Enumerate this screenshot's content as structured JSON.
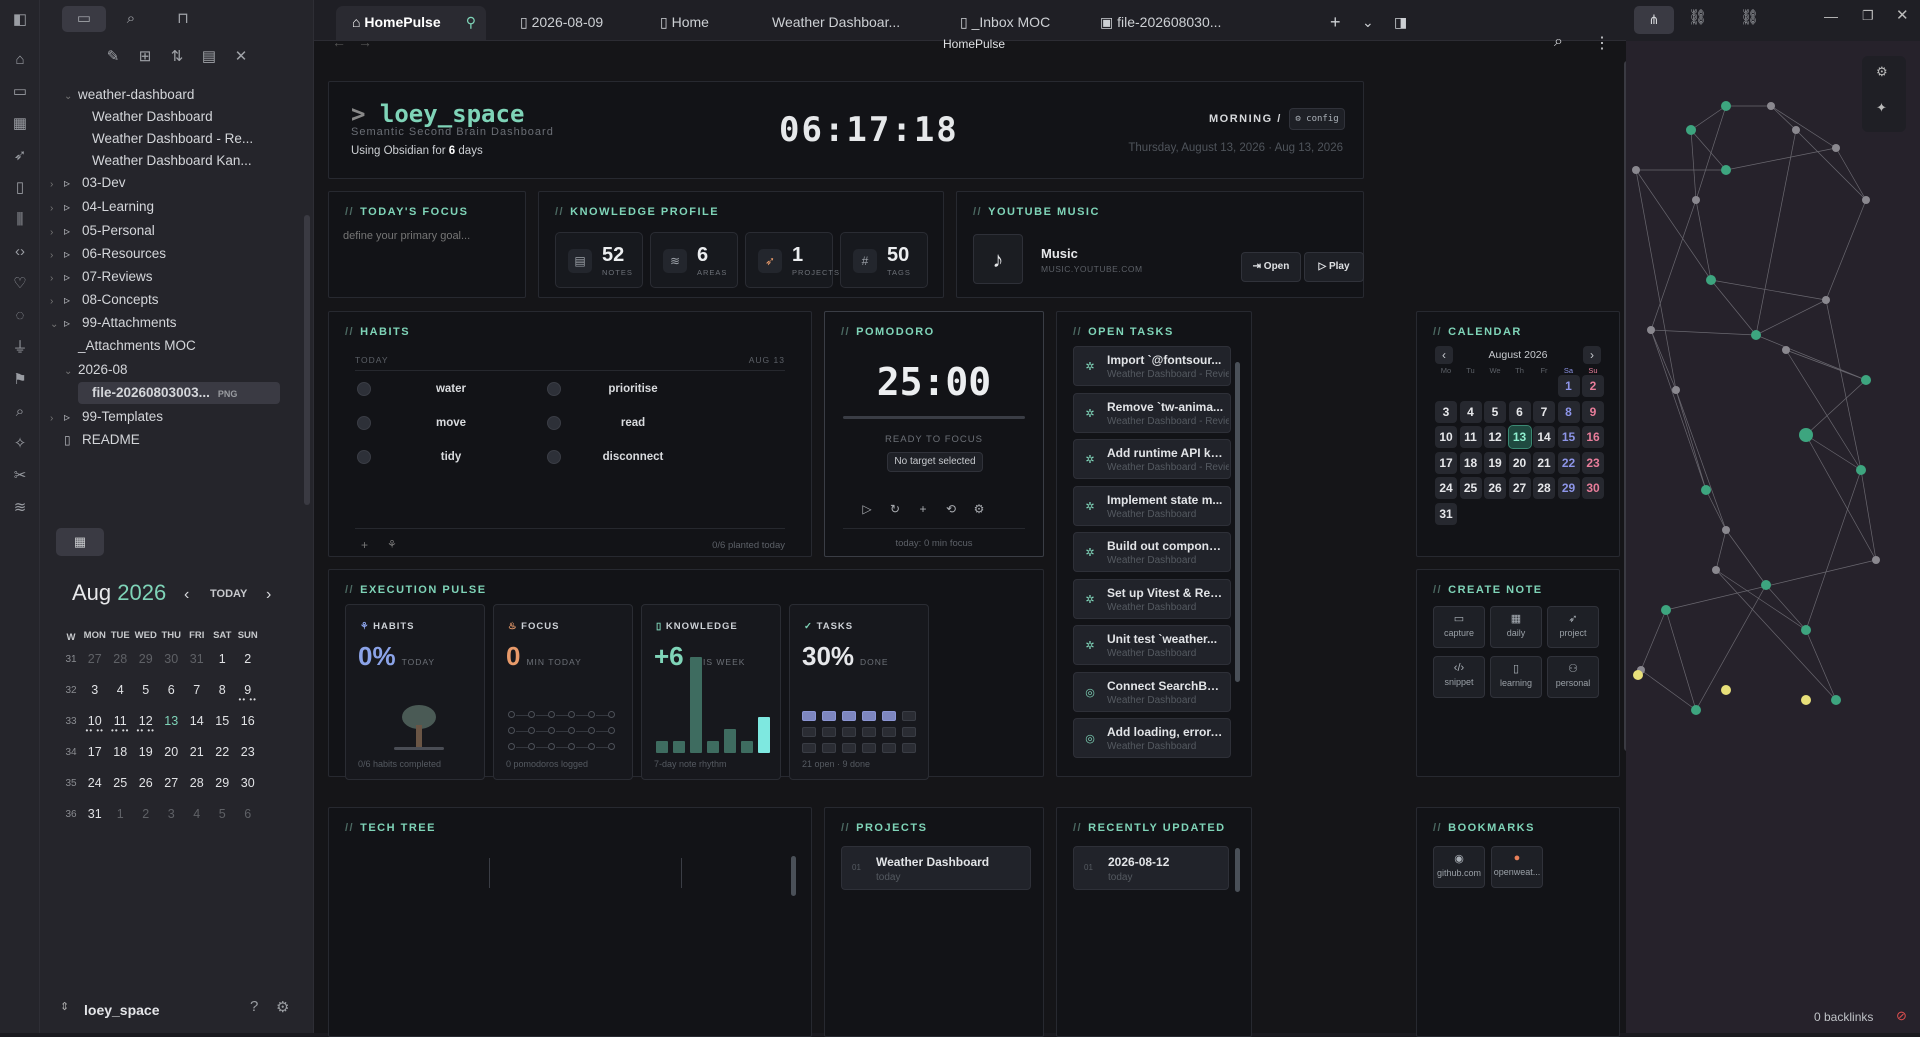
{
  "sidebar": {
    "tree": [
      {
        "label": "weather-dashboard",
        "type": "folder-open",
        "indent": 1
      },
      {
        "label": "Weather Dashboard",
        "type": "file",
        "indent": 2
      },
      {
        "label": "Weather Dashboard - Re...",
        "type": "file",
        "indent": 2
      },
      {
        "label": "Weather Dashboard Kan...",
        "type": "file",
        "indent": 2
      },
      {
        "label": "03-Dev",
        "type": "folder",
        "indent": 0
      },
      {
        "label": "04-Learning",
        "type": "folder",
        "indent": 0
      },
      {
        "label": "05-Personal",
        "type": "folder",
        "indent": 0
      },
      {
        "label": "06-Resources",
        "type": "folder",
        "indent": 0
      },
      {
        "label": "07-Reviews",
        "type": "folder",
        "indent": 0
      },
      {
        "label": "08-Concepts",
        "type": "folder",
        "indent": 0
      },
      {
        "label": "99-Attachments",
        "type": "folder-open",
        "indent": 0
      },
      {
        "label": "_Attachments MOC",
        "type": "file",
        "indent": 1
      },
      {
        "label": "2026-08",
        "type": "folder-open",
        "indent": 1
      },
      {
        "label": "file-20260803003...",
        "badge": "PNG",
        "type": "selected",
        "indent": 2
      },
      {
        "label": "99-Templates",
        "type": "folder",
        "indent": 0
      },
      {
        "label": "README",
        "type": "file",
        "indent": 0
      }
    ],
    "vault_name": "loey_space",
    "calendar": {
      "month": "Aug",
      "year": "2026",
      "today_label": "TODAY",
      "headers": [
        "W",
        "MON",
        "TUE",
        "WED",
        "THU",
        "FRI",
        "SAT",
        "SUN"
      ],
      "weeks": [
        {
          "wk": "31",
          "days": [
            "27",
            "28",
            "29",
            "30",
            "31",
            "1",
            "2"
          ]
        },
        {
          "wk": "32",
          "days": [
            "3",
            "4",
            "5",
            "6",
            "7",
            "8",
            "9"
          ]
        },
        {
          "wk": "33",
          "days": [
            "10",
            "11",
            "12",
            "13",
            "14",
            "15",
            "16"
          ]
        },
        {
          "wk": "34",
          "days": [
            "17",
            "18",
            "19",
            "20",
            "21",
            "22",
            "23"
          ]
        },
        {
          "wk": "35",
          "days": [
            "24",
            "25",
            "26",
            "27",
            "28",
            "29",
            "30"
          ]
        },
        {
          "wk": "36",
          "days": [
            "31",
            "1",
            "2",
            "3",
            "4",
            "5",
            "6"
          ]
        }
      ]
    }
  },
  "tabs": [
    {
      "label": "HomePulse",
      "icon": "home-icon"
    },
    {
      "label": "2026-08-09",
      "icon": "file-icon"
    },
    {
      "label": "Home",
      "icon": "file-icon"
    },
    {
      "label": "Weather Dashboar...",
      "icon": ""
    },
    {
      "label": "_Inbox MOC",
      "icon": "file-icon"
    },
    {
      "label": "file-202608030...",
      "icon": "image-icon"
    }
  ],
  "view_title": "HomePulse",
  "header": {
    "prompt": ">",
    "title": "loey_space",
    "subtitle": "Semantic Second Brain Dashboard",
    "using_prefix": "Using Obsidian for ",
    "using_days": "6",
    "using_suffix": " days",
    "clock": "06:17:18",
    "period": "MORNING /",
    "config": "⚙ config",
    "date": "Thursday, August 13, 2026 · Aug 13, 2026"
  },
  "focus": {
    "title": "TODAY'S FOCUS",
    "placeholder": "define your primary goal..."
  },
  "knowledge": {
    "title": "KNOWLEDGE PROFILE",
    "cards": [
      {
        "value": "52",
        "label": "NOTES",
        "icon": "notes-icon"
      },
      {
        "value": "6",
        "label": "AREAS",
        "icon": "layers-icon"
      },
      {
        "value": "1",
        "label": "PROJECTS",
        "icon": "rocket-icon"
      },
      {
        "value": "50",
        "label": "TAGS",
        "icon": "hash-icon"
      }
    ]
  },
  "youtube": {
    "title": "YOUTUBE MUSIC",
    "name": "Music",
    "url": "MUSIC.YOUTUBE.COM",
    "open": "Open",
    "play": "Play"
  },
  "habits": {
    "title": "HABITS",
    "today": "TODAY",
    "date": "AUG 13",
    "items": [
      "water",
      "prioritise",
      "move",
      "read",
      "tidy",
      "disconnect"
    ],
    "footer": "0/6 planted today"
  },
  "pomodoro": {
    "title": "POMODORO",
    "time": "25:00",
    "status": "READY TO FOCUS",
    "target": "No target selected",
    "footer": "today: 0 min focus"
  },
  "tasks": {
    "title": "OPEN TASKS",
    "items": [
      {
        "t": "Import `@fontsour...",
        "s": "Weather Dashboard - Review",
        "icon": "gear-icon"
      },
      {
        "t": "Remove `tw-anima...",
        "s": "Weather Dashboard - Review",
        "icon": "gear-icon"
      },
      {
        "t": "Add runtime API ke...",
        "s": "Weather Dashboard - Review",
        "icon": "gear-icon"
      },
      {
        "t": "Implement state m...",
        "s": "Weather Dashboard",
        "icon": "gear-icon"
      },
      {
        "t": "Build out compone...",
        "s": "Weather Dashboard",
        "icon": "gear-icon"
      },
      {
        "t": "Set up Vitest & Reac...",
        "s": "Weather Dashboard",
        "icon": "gear-icon"
      },
      {
        "t": "Unit test `weather...",
        "s": "Weather Dashboard",
        "icon": "gear-icon"
      },
      {
        "t": "Connect SearchBar ...",
        "s": "Weather Dashboard",
        "icon": "circle-icon"
      },
      {
        "t": "Add loading, error, ...",
        "s": "Weather Dashboard",
        "icon": "circle-icon"
      }
    ]
  },
  "calendar": {
    "title": "CALENDAR",
    "month": "August 2026",
    "headers": [
      "Mo",
      "Tu",
      "We",
      "Th",
      "Fr",
      "Sa",
      "Su"
    ],
    "days": [
      "1",
      "2",
      "3",
      "4",
      "5",
      "6",
      "7",
      "8",
      "9",
      "10",
      "11",
      "12",
      "13",
      "14",
      "15",
      "16",
      "17",
      "18",
      "19",
      "20",
      "21",
      "22",
      "23",
      "24",
      "25",
      "26",
      "27",
      "28",
      "29",
      "30",
      "31"
    ],
    "today": "13"
  },
  "create_note": {
    "title": "CREATE NOTE",
    "items": [
      {
        "label": "capture",
        "icon": "inbox-icon"
      },
      {
        "label": "daily",
        "icon": "calendar-icon"
      },
      {
        "label": "project",
        "icon": "rocket-icon"
      },
      {
        "label": "snippet",
        "icon": "code-icon"
      },
      {
        "label": "learning",
        "icon": "book-icon"
      },
      {
        "label": "personal",
        "icon": "user-icon"
      }
    ]
  },
  "pulse": {
    "title": "EXECUTION PULSE",
    "cards": [
      {
        "head": "HABITS",
        "value": "0%",
        "unit": "TODAY",
        "foot": "0/6 habits completed",
        "color": "#8ba3e8"
      },
      {
        "head": "FOCUS",
        "value": "0",
        "unit": "MIN TODAY",
        "foot": "0 pomodoros logged",
        "color": "#e89a6a"
      },
      {
        "head": "KNOWLEDGE",
        "value": "+6",
        "unit": "THIS WEEK",
        "foot": "7-day note rhythm",
        "color": "#7fd4b8"
      },
      {
        "head": "TASKS",
        "value": "30%",
        "unit": "DONE",
        "foot": "21 open · 9 done",
        "color": "#e6e7ea"
      }
    ],
    "note_rhythm": [
      1,
      1,
      8,
      1,
      2,
      1,
      3
    ],
    "tasks_done_cells": 5
  },
  "bottom": {
    "tech_tree": "TECH TREE",
    "projects": "PROJECTS",
    "project_item": {
      "num": "01",
      "name": "Weather Dashboard",
      "when": "today"
    },
    "recent": "RECENTLY UPDATED",
    "recent_item": {
      "num": "01",
      "name": "2026-08-12",
      "when": "today"
    },
    "bookmarks": "BOOKMARKS",
    "bm": [
      {
        "label": "github.com",
        "icon": "github-icon"
      },
      {
        "label": "openweat...",
        "icon": "weather-icon"
      }
    ]
  },
  "status": {
    "backlinks": "0 backlinks"
  },
  "colors": {
    "accent": "#7fd4b8",
    "bg": "#151518",
    "panel": "#121317",
    "graph_node": "#3da57f",
    "graph_node_yellow": "#e8e07a"
  }
}
